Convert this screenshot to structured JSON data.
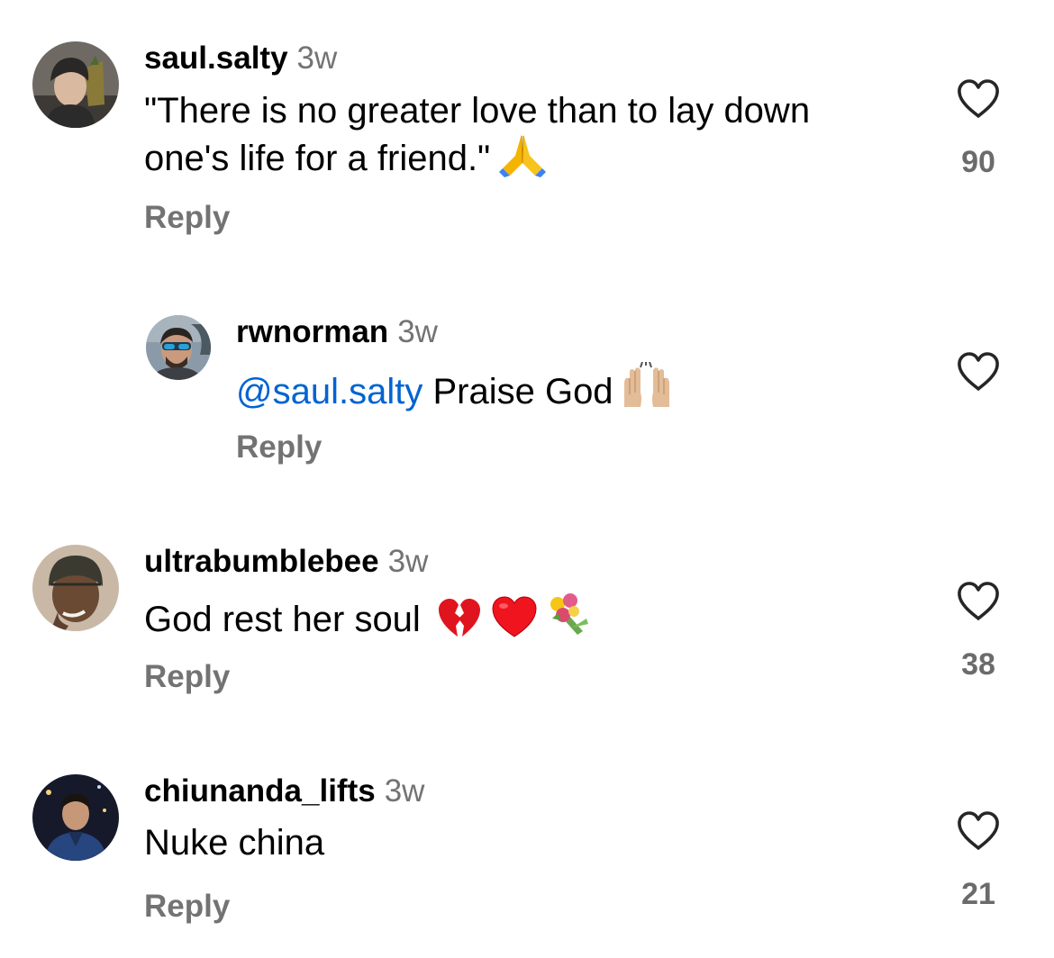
{
  "comments": [
    {
      "username": "saul.salty",
      "time": "3w",
      "text_lines": [
        "\"There is no greater love than to lay down",
        "one's life for a friend.\""
      ],
      "emoji": "folded-hands",
      "reply_label": "Reply",
      "likes": "90"
    },
    {
      "username": "rwnorman",
      "time": "3w",
      "mention": "@saul.salty",
      "text": " Praise God",
      "emoji": "raising-hands",
      "reply_label": "Reply",
      "likes": ""
    },
    {
      "username": "ultrabumblebee",
      "time": "3w",
      "text": "God rest her soul",
      "emojis": [
        "broken-heart",
        "red-heart",
        "bouquet"
      ],
      "reply_label": "Reply",
      "likes": "38"
    },
    {
      "username": "chiunanda_lifts",
      "time": "3w",
      "text": "Nuke china",
      "reply_label": "Reply",
      "likes": "21"
    }
  ],
  "colors": {
    "secondary_text": "#737373",
    "mention": "#0064d1",
    "like_icon": "#262626"
  }
}
